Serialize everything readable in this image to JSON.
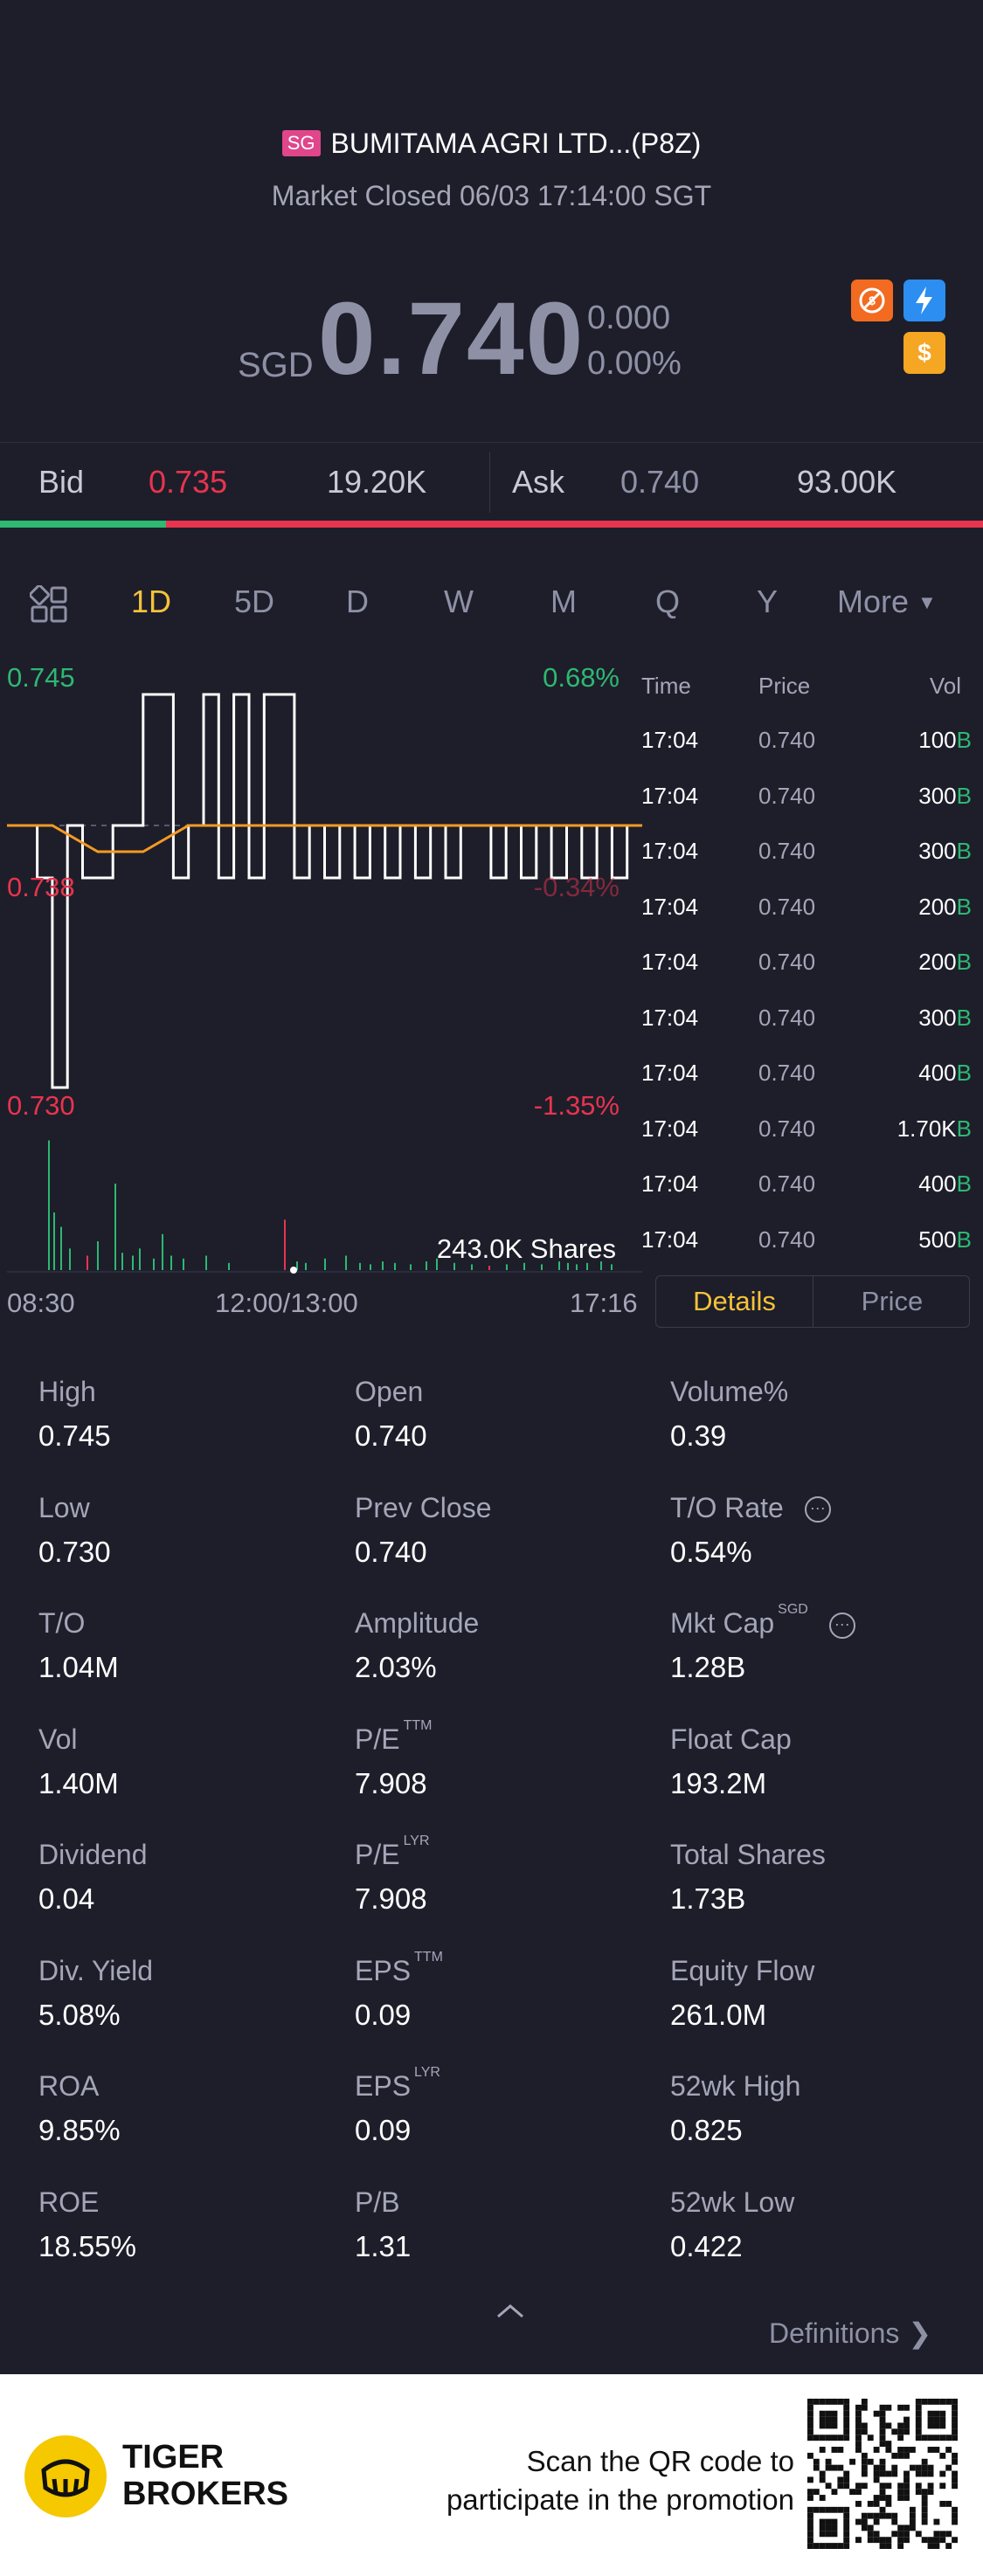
{
  "header": {
    "market_badge": "SG",
    "stock_name": "BUMITAMA AGRI LTD...(P8Z)",
    "market_status": "Market Closed 06/03 17:14:00 SGT"
  },
  "quote": {
    "currency": "SGD",
    "price": "0.740",
    "change": "0.000",
    "change_pct": "0.00%"
  },
  "orderbook": {
    "bid_label": "Bid",
    "bid_price": "0.735",
    "bid_size": "19.20K",
    "ask_label": "Ask",
    "ask_price": "0.740",
    "ask_size": "93.00K",
    "bid_ratio": 0.17
  },
  "tabs": {
    "items": [
      "1D",
      "5D",
      "D",
      "W",
      "M",
      "Q",
      "Y"
    ],
    "active": "1D",
    "more_label": "More"
  },
  "chart": {
    "y_high": "0.745",
    "y_high_pct": "0.68%",
    "y_mid": "0.738",
    "y_mid_pct": "-0.34%",
    "y_low": "0.730",
    "y_low_pct": "-1.35%",
    "volume_label": "243.0K Shares",
    "x_labels": [
      "08:30",
      "12:00/13:00",
      "17:16"
    ]
  },
  "chart_data": {
    "type": "line",
    "series": [
      {
        "values": [
          0.74,
          0.74,
          0.738,
          0.73,
          0.74,
          0.738,
          0.738,
          0.74,
          0.74,
          0.745,
          0.745,
          0.738,
          0.74,
          0.745,
          0.738,
          0.745,
          0.738,
          0.745,
          0.745,
          0.738,
          0.74,
          0.738,
          0.74,
          0.738,
          0.74,
          0.738,
          0.74,
          0.738,
          0.74,
          0.738,
          0.74,
          0.74,
          0.738,
          0.74,
          0.738,
          0.74,
          0.738,
          0.74,
          0.738,
          0.74,
          0.738,
          0.74,
          0.74
        ]
      },
      {
        "values": [
          0.74,
          0.74,
          0.739,
          0.739,
          0.74,
          0.74,
          0.74,
          0.74,
          0.74,
          0.74,
          0.74,
          0.74,
          0.74,
          0.74,
          0.74
        ]
      }
    ],
    "ylim": [
      0.73,
      0.745
    ]
  },
  "ticks": {
    "headers": [
      "Time",
      "Price",
      "Vol"
    ],
    "rows": [
      {
        "time": "17:04",
        "price": "0.740",
        "vol": "100",
        "side": "B"
      },
      {
        "time": "17:04",
        "price": "0.740",
        "vol": "300",
        "side": "B"
      },
      {
        "time": "17:04",
        "price": "0.740",
        "vol": "300",
        "side": "B"
      },
      {
        "time": "17:04",
        "price": "0.740",
        "vol": "200",
        "side": "B"
      },
      {
        "time": "17:04",
        "price": "0.740",
        "vol": "200",
        "side": "B"
      },
      {
        "time": "17:04",
        "price": "0.740",
        "vol": "300",
        "side": "B"
      },
      {
        "time": "17:04",
        "price": "0.740",
        "vol": "400",
        "side": "B"
      },
      {
        "time": "17:04",
        "price": "0.740",
        "vol": "1.70K",
        "side": "B"
      },
      {
        "time": "17:04",
        "price": "0.740",
        "vol": "400",
        "side": "B"
      },
      {
        "time": "17:04",
        "price": "0.740",
        "vol": "500",
        "side": "B"
      }
    ],
    "details_tab": "Details",
    "price_tab": "Price"
  },
  "stats": [
    {
      "label": "High",
      "value": "0.745"
    },
    {
      "label": "Open",
      "value": "0.740"
    },
    {
      "label": "Volume%",
      "value": "0.39"
    },
    {
      "label": "Low",
      "value": "0.730"
    },
    {
      "label": "Prev Close",
      "value": "0.740"
    },
    {
      "label": "T/O Rate",
      "value": "0.54%"
    },
    {
      "label": "T/O",
      "value": "1.04M"
    },
    {
      "label": "Amplitude",
      "value": "2.03%"
    },
    {
      "label": "Mkt Cap",
      "value": "1.28B",
      "sup": "SGD"
    },
    {
      "label": "Vol",
      "value": "1.40M"
    },
    {
      "label": "P/E",
      "value": "7.908",
      "sup": "TTM"
    },
    {
      "label": "Float Cap",
      "value": "193.2M"
    },
    {
      "label": "Dividend",
      "value": "0.04"
    },
    {
      "label": "P/E",
      "value": "7.908",
      "sup": "LYR"
    },
    {
      "label": "Total Shares",
      "value": "1.73B"
    },
    {
      "label": "Div. Yield",
      "value": "5.08%"
    },
    {
      "label": "EPS",
      "value": "0.09",
      "sup": "TTM"
    },
    {
      "label": "Equity Flow",
      "value": "261.0M"
    },
    {
      "label": "ROA",
      "value": "9.85%"
    },
    {
      "label": "EPS",
      "value": "0.09",
      "sup": "LYR"
    },
    {
      "label": "52wk High",
      "value": "0.825"
    },
    {
      "label": "ROE",
      "value": "18.55%"
    },
    {
      "label": "P/B",
      "value": "1.31"
    },
    {
      "label": "52wk Low",
      "value": "0.422"
    }
  ],
  "definitions_label": "Definitions",
  "footer": {
    "brand_line1": "TIGER",
    "brand_line2": "BROKERS",
    "promo_line1": "Scan the QR code to",
    "promo_line2": "participate in the promotion"
  },
  "colors": {
    "background": "#1d1e2a",
    "up": "#2eb872",
    "down": "#e8344e",
    "accent": "#f5c23a",
    "avg_line": "#f59a23"
  }
}
